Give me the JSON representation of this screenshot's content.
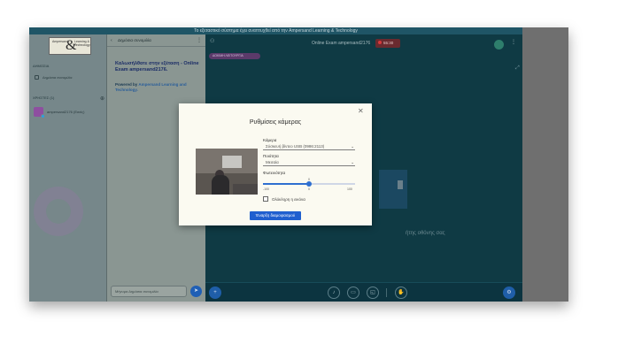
{
  "topbar": {
    "text": "Το εξεταστικό σύστημα έχει αναπτυχθεί από την Ampersand Learning & Technology"
  },
  "logo": {
    "left_text": "Ampersand",
    "right_text": "Learning & Technology",
    "symbol": "&"
  },
  "sidebar": {
    "section1": "ΔΗΜΟΣΙΑ",
    "item1": "Δημόσια συνομιλία",
    "section2": "ΧΡΗΣΤΕΣ (1)",
    "user": "ampersand2176 (Εσείς)"
  },
  "chat": {
    "header": "Δημόσια συνομιλία",
    "welcome": "Καλωσήλθατε στην εξέταση - Online Exam ampersand2176.",
    "powered_prefix": "Powered by ",
    "powered_brand": "Ampersand Learning and Technology.",
    "input_placeholder": "Μήνυμα Δημόσια συνομιλία"
  },
  "stage": {
    "title": "Online Exam ampersand2176",
    "rec_time": "55:30",
    "badge": "ΔΟΚΙΜΗ ΛΕΙΤΟΥΡΓΙΑ",
    "screen_caption": "ήτης οθόνης σας"
  },
  "modal": {
    "title": "Ρυθμίσεις κάμερας",
    "camera_label": "Κάμερα",
    "camera_value": "Σύσκευή βίντεο USB (0986:2113)",
    "quality_label": "Ποιότητα",
    "quality_value": "Μεσαία",
    "brightness_label": "Φωτεινότητα",
    "brightness_value": "0",
    "brightness_min": "-100",
    "brightness_mid": "0",
    "brightness_max": "100",
    "brightness_fraction": 0.5,
    "checkbox_label": "Ολόκληρη η εικόνα",
    "start_button": "Έναρξη διαμοιρασμού"
  },
  "colors": {
    "accent": "#1f5fcf",
    "rec": "#d6393b",
    "stage_bg": "#0f3a44"
  }
}
